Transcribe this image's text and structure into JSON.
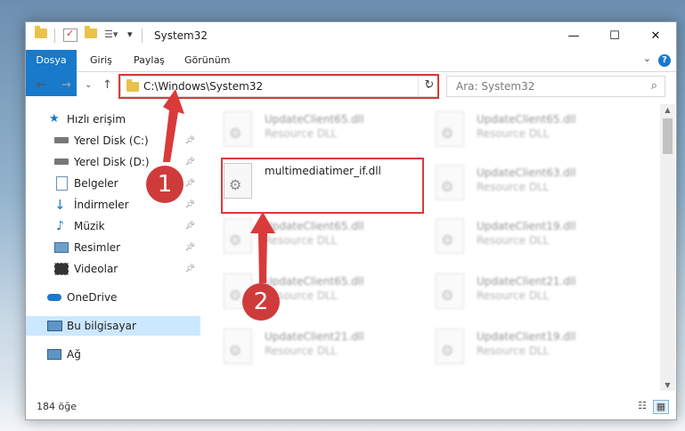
{
  "window": {
    "title": "System32",
    "minimize_glyph": "—",
    "maximize_glyph": "☐",
    "close_glyph": "✕"
  },
  "ribbon": {
    "tabs": [
      "Dosya",
      "Giriş",
      "Paylaş",
      "Görünüm"
    ],
    "help_label": "?",
    "collapse_glyph": "⌄"
  },
  "nav": {
    "back_glyph": "←",
    "forward_glyph": "→",
    "recent_glyph": "⌄",
    "up_glyph": "↑",
    "address": "C:\\Windows\\System32",
    "address_dropdown_glyph": "⌄",
    "refresh_glyph": "↻",
    "search_placeholder": "Ara: System32",
    "search_glyph": "⌕"
  },
  "sidebar": {
    "quick_access": "Hızlı erişim",
    "items": [
      {
        "label": "Yerel Disk (C:)",
        "pinned": true
      },
      {
        "label": "Yerel Disk (D:)",
        "pinned": true
      },
      {
        "label": "Belgeler",
        "pinned": true
      },
      {
        "label": "İndirmeler",
        "pinned": true
      },
      {
        "label": "Müzik",
        "pinned": true
      },
      {
        "label": "Resimler",
        "pinned": true
      },
      {
        "label": "Videolar",
        "pinned": true
      }
    ],
    "onedrive": "OneDrive",
    "this_pc": "Bu bilgisayar",
    "network": "Ağ"
  },
  "files": {
    "left_column": [
      {
        "name": "UpdateClient65.dll",
        "desc": "Resource DLL",
        "blurred": true
      },
      {
        "name": "multimediatimer_if.dll",
        "desc": "",
        "blurred": false
      },
      {
        "name": "UpdateClient65.dll",
        "desc": "Resource DLL",
        "blurred": true
      },
      {
        "name": "UpdateClient65.dll",
        "desc": "Resource DLL",
        "blurred": true
      },
      {
        "name": "UpdateClient21.dll",
        "desc": "Resource DLL",
        "blurred": true
      }
    ],
    "right_column": [
      {
        "name": "UpdateClient65.dll",
        "desc": "Resource DLL",
        "blurred": true
      },
      {
        "name": "UpdateClient63.dll",
        "desc": "Resource DLL",
        "blurred": true
      },
      {
        "name": "UpdateClient19.dll",
        "desc": "Resource DLL",
        "blurred": true
      },
      {
        "name": "UpdateClient21.dll",
        "desc": "Resource DLL",
        "blurred": true
      },
      {
        "name": "UpdateClient19.dll",
        "desc": "Resource DLL",
        "blurred": true
      }
    ]
  },
  "status": {
    "item_count": "184 öğe"
  },
  "annotations": {
    "marker1": "1",
    "marker2": "2",
    "color": "#d93a3a"
  }
}
